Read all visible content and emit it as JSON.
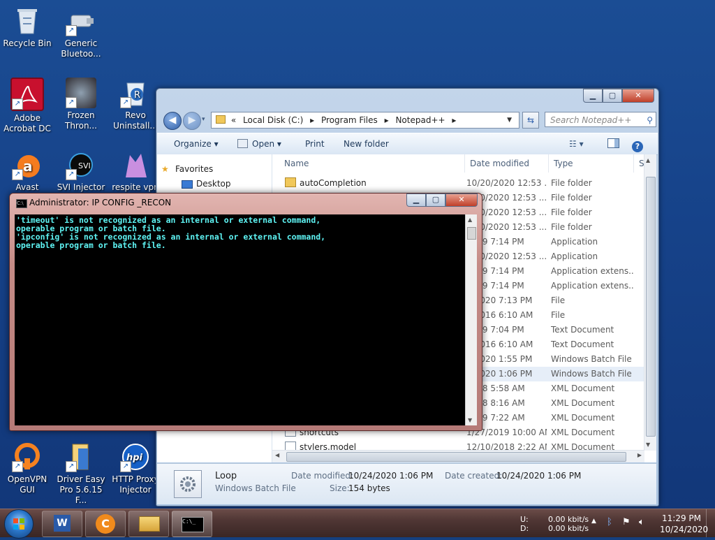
{
  "desktop": {
    "icons": [
      {
        "label": "Recycle Bin",
        "icon": "recycle-bin-icon"
      },
      {
        "label": "Generic Bluetoo...",
        "icon": "bluetooth-icon"
      },
      {
        "label": "Adobe Acrobat DC",
        "icon": "acrobat-icon"
      },
      {
        "label": "Frozen Thron...",
        "icon": "frozen-throne-icon"
      },
      {
        "label": "Revo Uninstall...",
        "icon": "revo-uninstaller-icon"
      },
      {
        "label": "Avast",
        "icon": "avast-icon"
      },
      {
        "label": "SVI Injector",
        "icon": "svi-icon"
      },
      {
        "label": "respite vpn",
        "icon": "respite-icon"
      },
      {
        "label": "OpenVPN GUI",
        "icon": "openvpn-icon"
      },
      {
        "label": "Driver Easy Pro 5.6.15 F...",
        "icon": "driver-easy-icon"
      },
      {
        "label": "HTTP Proxy Injector",
        "icon": "http-proxy-icon"
      }
    ]
  },
  "explorer": {
    "window_controls": {
      "minimize": "▁",
      "maximize": "▢",
      "close": "✕"
    },
    "breadcrumb": [
      "«",
      "Local Disk (C:)",
      "▸",
      "Program Files",
      "▸",
      "Notepad++",
      "▸"
    ],
    "search_placeholder": "Search Notepad++",
    "toolbar": {
      "organize": "Organize ▾",
      "open": "Open ▾",
      "print": "Print",
      "new_folder": "New folder"
    },
    "nav": {
      "favorites": "Favorites",
      "desktop": "Desktop"
    },
    "columns": {
      "name": "Name",
      "date": "Date modified",
      "type": "Type",
      "size": "Si:"
    },
    "files": [
      {
        "name": "autoCompletion",
        "date": "10/20/2020 12:53 ...",
        "type": "File folder"
      },
      {
        "name": "",
        "date": "0/20/2020 12:53 ...",
        "type": "File folder"
      },
      {
        "name": "",
        "date": "0/20/2020 12:53 ...",
        "type": "File folder"
      },
      {
        "name": "",
        "date": "0/20/2020 12:53 ...",
        "type": "File folder"
      },
      {
        "name": "",
        "date": "2019 7:14 PM",
        "type": "Application"
      },
      {
        "name": "",
        "date": "0/20/2020 12:53 ...",
        "type": "Application"
      },
      {
        "name": "",
        "date": "2019 7:14 PM",
        "type": "Application extens..."
      },
      {
        "name": "",
        "date": "2019 7:14 PM",
        "type": "Application extens..."
      },
      {
        "name": "",
        "date": "0/2020 7:13 PM",
        "type": "File"
      },
      {
        "name": "",
        "date": "7/2016 6:10 AM",
        "type": "File"
      },
      {
        "name": "",
        "date": "2019 7:04 PM",
        "type": "Text Document"
      },
      {
        "name": "",
        "date": "7/2016 6:10 AM",
        "type": "Text Document"
      },
      {
        "name": "",
        "date": "4/2020 1:55 PM",
        "type": "Windows Batch File"
      },
      {
        "name": "",
        "date": "4/2020 1:06 PM",
        "type": "Windows Batch File"
      },
      {
        "name": "",
        "date": "2018 5:58 AM",
        "type": "XML Document"
      },
      {
        "name": "",
        "date": "2018 8:16 AM",
        "type": "XML Document"
      },
      {
        "name": "",
        "date": "2019 7:22 AM",
        "type": "XML Document"
      },
      {
        "name": "shortcuts",
        "date": "1/27/2019 10:00 AM",
        "type": "XML Document"
      },
      {
        "name": "stylers.model",
        "date": "12/10/2018 2:22 AM",
        "type": "XML Document"
      }
    ],
    "details": {
      "name": "Loop",
      "type": "Windows Batch File",
      "modified_label": "Date modified:",
      "modified": "10/24/2020 1:06 PM",
      "created_label": "Date created:",
      "created": "10/24/2020 1:06 PM",
      "size_label": "Size:",
      "size": "154 bytes"
    }
  },
  "cmd": {
    "title": "Administrator:  IP CONFIG _RECON",
    "icon_text": "C:\\",
    "output": "'timeout' is not recognized as an internal or external command,\noperable program or batch file.\n'ipconfig' is not recognized as an internal or external command,\noperable program or batch file.",
    "controls": {
      "minimize": "▁",
      "maximize": "▢",
      "close": "✕"
    }
  },
  "tray": {
    "u_label": "U:",
    "u_rate": "0.00 kbit/s",
    "d_label": "D:",
    "d_rate": "0.00 kbit/s",
    "time": "11:29 PM",
    "date": "10/24/2020"
  },
  "colors": {
    "console_text": "#5ff5f5",
    "desktop": "#1b4d94",
    "taskbar": "#4f3634"
  }
}
